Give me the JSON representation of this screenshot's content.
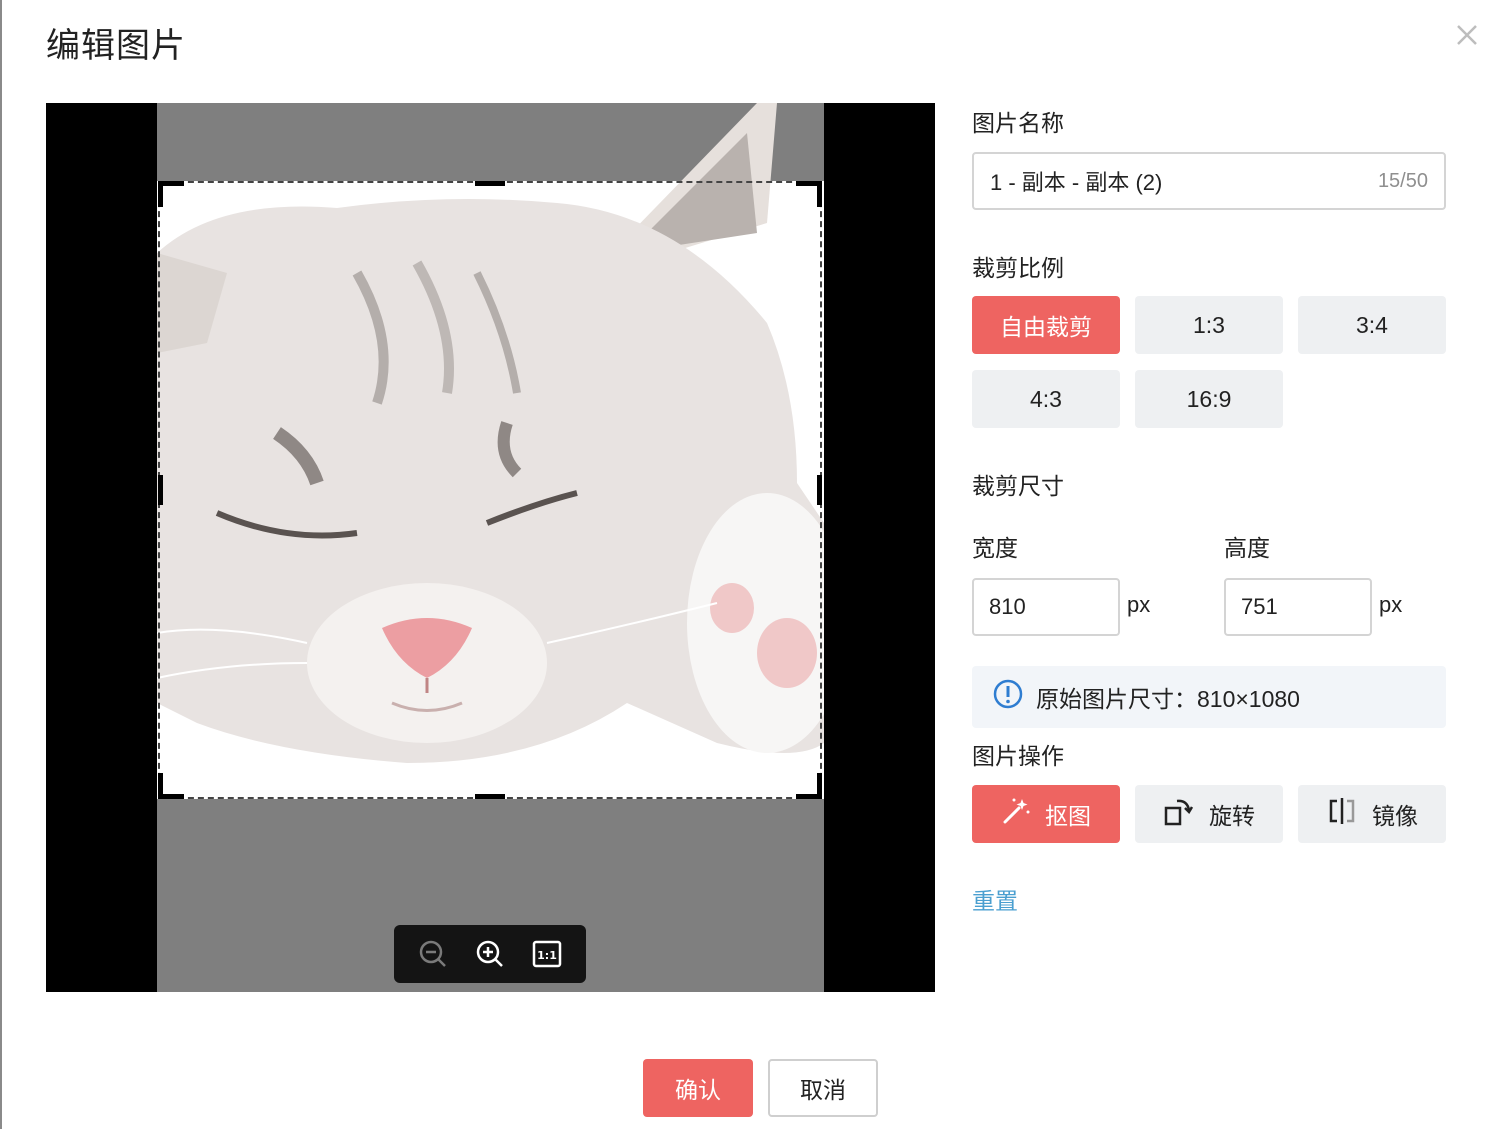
{
  "dialog": {
    "title": "编辑图片"
  },
  "panel": {
    "name_label": "图片名称",
    "name_value": "1 - 副本 - 副本 (2)",
    "name_count": "15/50",
    "ratio_label": "裁剪比例",
    "ratios": [
      "自由裁剪",
      "1:3",
      "3:4",
      "4:3",
      "16:9"
    ],
    "selected_ratio": "自由裁剪",
    "size_label": "裁剪尺寸",
    "width_label": "宽度",
    "height_label": "高度",
    "width_value": "810",
    "height_value": "751",
    "unit": "px",
    "original_size_text": "原始图片尺寸：810×1080",
    "ops_label": "图片操作",
    "ops": [
      "抠图",
      "旋转",
      "镜像"
    ],
    "reset_label": "重置"
  },
  "footer": {
    "confirm_label": "确认",
    "cancel_label": "取消"
  },
  "icons": {
    "close": "close-icon",
    "zoom_out": "zoom-out-icon",
    "zoom_in": "zoom-in-icon",
    "actual_size": "actual-size-icon",
    "info": "info-icon",
    "cutout": "magic-wand-icon",
    "rotate": "rotate-icon",
    "mirror": "mirror-icon"
  },
  "colors": {
    "primary": "#ee6461",
    "link": "#4a9fd0",
    "secondary_bg": "#eef0f2",
    "info_bg": "#f2f5f9"
  }
}
